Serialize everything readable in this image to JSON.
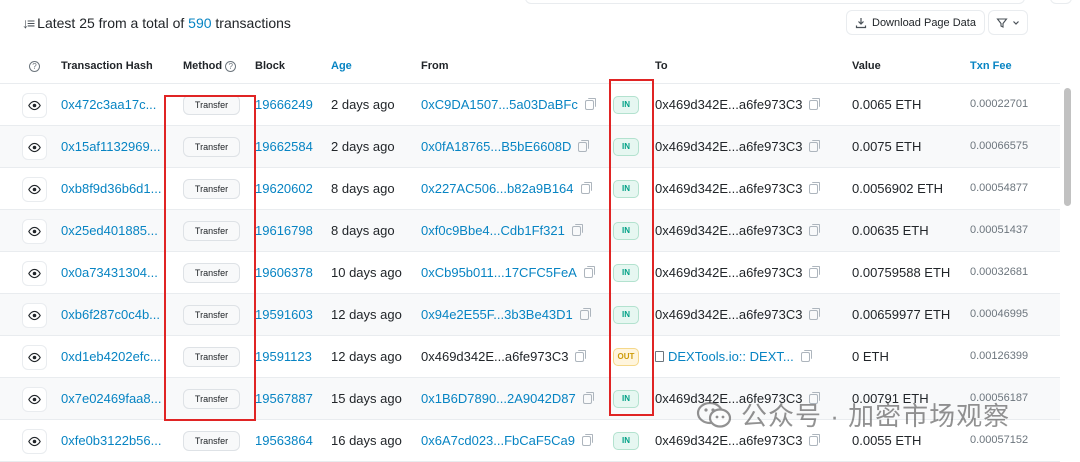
{
  "summary": {
    "prefix": "Latest 25 from a total of",
    "count": "590",
    "suffix": "transactions"
  },
  "toolbar": {
    "download_label": "Download Page Data",
    "filter_icon": "filter-icon"
  },
  "columns": {
    "hash": "Transaction Hash",
    "method": "Method",
    "block": "Block",
    "age": "Age",
    "from": "From",
    "to": "To",
    "value": "Value",
    "fee": "Txn Fee"
  },
  "rows": [
    {
      "hash": "0x472c3aa17c...",
      "method": "Transfer",
      "block": "19666249",
      "age": "2 days ago",
      "from": "0xC9DA1507...5a03DaBFc",
      "dir": "IN",
      "to": "0x469d342E...a6fe973C3",
      "value": "0.0065 ETH",
      "fee": "0.00022701"
    },
    {
      "hash": "0x15af1132969...",
      "method": "Transfer",
      "block": "19662584",
      "age": "2 days ago",
      "from": "0x0fA18765...B5bE6608D",
      "dir": "IN",
      "to": "0x469d342E...a6fe973C3",
      "value": "0.0075 ETH",
      "fee": "0.00066575"
    },
    {
      "hash": "0xb8f9d36b6d1...",
      "method": "Transfer",
      "block": "19620602",
      "age": "8 days ago",
      "from": "0x227AC506...b82a9B164",
      "dir": "IN",
      "to": "0x469d342E...a6fe973C3",
      "value": "0.0056902 ETH",
      "fee": "0.00054877"
    },
    {
      "hash": "0x25ed401885...",
      "method": "Transfer",
      "block": "19616798",
      "age": "8 days ago",
      "from": "0xf0c9Bbe4...Cdb1Ff321",
      "dir": "IN",
      "to": "0x469d342E...a6fe973C3",
      "value": "0.00635 ETH",
      "fee": "0.00051437"
    },
    {
      "hash": "0x0a73431304...",
      "method": "Transfer",
      "block": "19606378",
      "age": "10 days ago",
      "from": "0xCb95b011...17CFC5FeA",
      "dir": "IN",
      "to": "0x469d342E...a6fe973C3",
      "value": "0.00759588 ETH",
      "fee": "0.00032681"
    },
    {
      "hash": "0xb6f287c0c4b...",
      "method": "Transfer",
      "block": "19591603",
      "age": "12 days ago",
      "from": "0x94e2E55F...3b3Be43D1",
      "dir": "IN",
      "to": "0x469d342E...a6fe973C3",
      "value": "0.00659977 ETH",
      "fee": "0.00046995"
    },
    {
      "hash": "0xd1eb4202efc...",
      "method": "Transfer",
      "block": "19591123",
      "age": "12 days ago",
      "from": "0x469d342E...a6fe973C3",
      "dir": "OUT",
      "to": "DEXTools.io:: DEXT...",
      "value": "0 ETH",
      "fee": "0.00126399"
    },
    {
      "hash": "0x7e02469faa8...",
      "method": "Transfer",
      "block": "19567887",
      "age": "15 days ago",
      "from": "0x1B6D7890...2A9042D87",
      "dir": "IN",
      "to": "0x469d342E...a6fe973C3",
      "value": "0.00791 ETH",
      "fee": "0.00056187"
    },
    {
      "hash": "0xfe0b3122b56...",
      "method": "Transfer",
      "block": "19563864",
      "age": "16 days ago",
      "from": "0x6A7cd023...FbCaF5Ca9",
      "dir": "IN",
      "to": "0x469d342E...a6fe973C3",
      "value": "0.0055 ETH",
      "fee": "0.00057152"
    }
  ],
  "watermark": {
    "text": "公众号 · 加密市场观察"
  },
  "colors": {
    "link": "#0784c3",
    "highlight_box": "#e02424",
    "in_badge": "#00a186",
    "out_badge": "#cc9a06"
  }
}
